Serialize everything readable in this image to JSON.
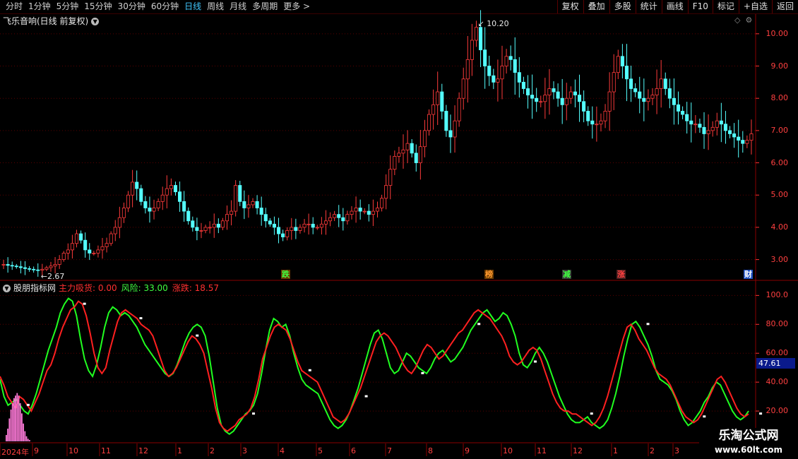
{
  "toolbar": {
    "periods": [
      "分时",
      "1分钟",
      "5分钟",
      "15分钟",
      "30分钟",
      "60分钟",
      "日线",
      "周线",
      "月线",
      "多周期",
      "更多 >"
    ],
    "active_period": "日线",
    "right_tools": [
      "复权",
      "叠加",
      "多股",
      "统计",
      "画线",
      "F10",
      "标记",
      "+自选",
      "返回"
    ]
  },
  "main_panel": {
    "title": "飞乐音响(日线 前复权)",
    "y_ticks": [
      "10.00",
      "9.00",
      "8.00",
      "7.00",
      "6.00",
      "5.00",
      "4.00",
      "3.00"
    ],
    "high_label": "10.20",
    "low_label": "2.67",
    "events": [
      {
        "label": "跌",
        "color": "#40ff40",
        "bg": "#6a3a00"
      },
      {
        "label": "榜",
        "color": "#ff9a30",
        "bg": "#6a3a00"
      },
      {
        "label": "减",
        "color": "#40ff40",
        "bg": "#3a3a3a"
      },
      {
        "label": "涨",
        "color": "#ff4040",
        "bg": "#4a2020"
      },
      {
        "label": "财",
        "color": "#ffffff",
        "bg": "#2050c0"
      }
    ]
  },
  "indicator_panel": {
    "name": "股朋指标网",
    "zhuli_label": "主力吸货: 0.00",
    "fengxian_label": "风险: 33.00",
    "zhangdie_label": "涨跌: 18.57",
    "y_ticks": [
      "100.0",
      "80.00",
      "60.00",
      "40.00",
      "20.00"
    ],
    "current_value": "47.61"
  },
  "date_axis": [
    "2024年",
    "9",
    "10",
    "11",
    "12",
    "1",
    "2",
    "3",
    "4",
    "5",
    "6",
    "7",
    "8",
    "9",
    "10",
    "11",
    "12",
    "1",
    "2",
    "3"
  ],
  "watermark": {
    "line1": "乐淘公式网",
    "line2": "www.60lt.com"
  },
  "chart_data": {
    "type": "candlestick",
    "price_range": [
      2.4,
      10.5
    ],
    "closes": [
      2.85,
      2.82,
      2.8,
      2.78,
      2.75,
      2.72,
      2.7,
      2.68,
      2.67,
      2.7,
      2.75,
      2.8,
      2.85,
      3.0,
      3.2,
      3.3,
      3.5,
      3.8,
      3.6,
      3.3,
      3.2,
      3.2,
      3.3,
      3.4,
      3.5,
      3.8,
      4.0,
      4.3,
      4.6,
      5.0,
      5.4,
      5.2,
      4.8,
      4.6,
      4.5,
      4.6,
      4.8,
      5.0,
      5.2,
      5.3,
      5.1,
      4.8,
      4.5,
      4.2,
      4.0,
      3.9,
      3.9,
      4.0,
      4.0,
      4.1,
      4.0,
      4.2,
      4.4,
      4.5,
      5.3,
      4.8,
      4.6,
      4.7,
      4.8,
      4.6,
      4.4,
      4.2,
      4.1,
      4.0,
      3.8,
      3.7,
      3.9,
      4.0,
      3.9,
      4.0,
      4.1,
      4.1,
      4.0,
      4.0,
      4.1,
      4.2,
      4.3,
      4.4,
      4.3,
      4.2,
      4.4,
      4.5,
      4.6,
      4.5,
      4.5,
      4.4,
      4.5,
      4.6,
      4.9,
      5.3,
      5.8,
      6.2,
      6.3,
      6.4,
      6.6,
      6.3,
      6.0,
      6.5,
      7.0,
      7.5,
      7.8,
      8.2,
      7.6,
      7.0,
      6.8,
      7.3,
      8.0,
      8.6,
      9.2,
      9.8,
      10.2,
      9.5,
      9.0,
      8.7,
      8.5,
      8.6,
      9.0,
      9.3,
      9.2,
      8.8,
      8.5,
      8.3,
      8.1,
      8.0,
      7.9,
      7.9,
      8.1,
      8.3,
      8.2,
      8.0,
      7.8,
      8.0,
      8.2,
      8.1,
      7.9,
      7.6,
      7.3,
      7.2,
      7.2,
      7.3,
      7.6,
      8.2,
      8.8,
      9.3,
      9.0,
      8.6,
      8.3,
      8.2,
      8.0,
      7.9,
      8.0,
      8.1,
      8.3,
      8.6,
      8.3,
      8.0,
      7.8,
      7.6,
      7.5,
      7.3,
      7.2,
      7.2,
      7.1,
      6.9,
      7.0,
      7.1,
      7.3,
      7.2,
      7.0,
      6.9,
      6.8,
      6.7,
      6.6,
      6.7,
      6.9
    ],
    "zhangdie": [
      44,
      38,
      30,
      26,
      22,
      30,
      28,
      24,
      20,
      26,
      32,
      40,
      48,
      52,
      60,
      70,
      78,
      84,
      90,
      92,
      96,
      94,
      86,
      74,
      60,
      50,
      46,
      50,
      62,
      72,
      82,
      88,
      90,
      88,
      86,
      84,
      80,
      78,
      76,
      72,
      64,
      56,
      48,
      44,
      46,
      50,
      56,
      62,
      68,
      72,
      70,
      66,
      60,
      48,
      36,
      22,
      12,
      8,
      6,
      8,
      10,
      14,
      16,
      18,
      22,
      30,
      42,
      56,
      64,
      72,
      78,
      80,
      78,
      76,
      70,
      62,
      54,
      48,
      46,
      44,
      42,
      40,
      34,
      28,
      22,
      16,
      14,
      12,
      14,
      18,
      24,
      30,
      36,
      44,
      52,
      60,
      68,
      72,
      74,
      72,
      68,
      64,
      58,
      52,
      48,
      46,
      50,
      56,
      62,
      66,
      64,
      60,
      56,
      58,
      62,
      66,
      70,
      74,
      76,
      80,
      84,
      88,
      90,
      88,
      86,
      84,
      80,
      76,
      72,
      66,
      58,
      54,
      52,
      54,
      58,
      62,
      64,
      62,
      56,
      48,
      40,
      32,
      26,
      22,
      20,
      20,
      18,
      18,
      16,
      14,
      12,
      10,
      12,
      16,
      22,
      30,
      40,
      50,
      60,
      70,
      78,
      80,
      76,
      70,
      66,
      62,
      56,
      50,
      46,
      44,
      42,
      38,
      32,
      26,
      20,
      16,
      14,
      12,
      14,
      18,
      24,
      30,
      36,
      42,
      44,
      40,
      34,
      28,
      22,
      18,
      16,
      18
    ],
    "fengxian": [
      42,
      30,
      24,
      26,
      28,
      24,
      20,
      18,
      24,
      32,
      42,
      52,
      62,
      70,
      78,
      88,
      94,
      98,
      96,
      86,
      70,
      56,
      48,
      44,
      52,
      64,
      78,
      88,
      92,
      90,
      86,
      88,
      86,
      82,
      78,
      72,
      66,
      62,
      58,
      54,
      50,
      46,
      44,
      46,
      52,
      60,
      68,
      74,
      78,
      80,
      78,
      72,
      58,
      40,
      22,
      10,
      6,
      4,
      6,
      10,
      14,
      18,
      20,
      24,
      32,
      46,
      62,
      76,
      84,
      82,
      78,
      80,
      72,
      60,
      50,
      42,
      38,
      36,
      34,
      32,
      26,
      20,
      14,
      10,
      8,
      10,
      14,
      20,
      28,
      36,
      46,
      56,
      66,
      74,
      76,
      70,
      60,
      50,
      46,
      48,
      54,
      60,
      58,
      54,
      50,
      48,
      46,
      50,
      56,
      60,
      62,
      58,
      54,
      56,
      60,
      64,
      70,
      76,
      80,
      84,
      88,
      90,
      86,
      82,
      84,
      88,
      86,
      80,
      72,
      60,
      52,
      50,
      54,
      60,
      64,
      60,
      54,
      46,
      38,
      30,
      24,
      18,
      14,
      12,
      12,
      14,
      16,
      12,
      10,
      8,
      10,
      14,
      22,
      32,
      44,
      58,
      70,
      80,
      82,
      78,
      72,
      66,
      58,
      48,
      42,
      40,
      38,
      34,
      28,
      20,
      14,
      10,
      12,
      16,
      20,
      26,
      30,
      36,
      40,
      38,
      32,
      26,
      20,
      16,
      14,
      16,
      20
    ],
    "volume_hist": [
      5,
      10,
      18,
      25,
      30,
      34,
      36,
      38,
      36,
      30,
      22,
      14,
      8,
      4,
      2,
      1,
      0,
      0,
      0,
      0,
      0,
      0,
      0,
      0,
      0,
      0,
      0,
      0,
      0,
      0
    ]
  }
}
